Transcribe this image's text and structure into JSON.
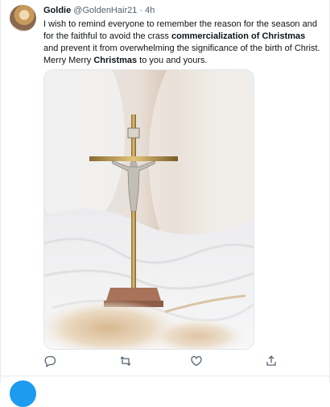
{
  "tweet": {
    "display_name": "Goldie",
    "handle": "@GoldenHair21",
    "separator": "·",
    "timestamp": "4h",
    "text_parts": [
      "I wish to remind everyone to remember the reason for the season and for the faithful to avoid the crass ",
      "commercialization of Christmas",
      " and prevent it from overwhelming the significance of the birth of Christ. Merry Merry ",
      "Christmas",
      " to you and yours."
    ]
  },
  "media": {
    "icon": "crucifix-photo"
  },
  "actions": [
    {
      "name": "reply",
      "icon": "reply-icon"
    },
    {
      "name": "retweet",
      "icon": "retweet-icon"
    },
    {
      "name": "like",
      "icon": "heart-icon"
    },
    {
      "name": "share",
      "icon": "share-icon"
    }
  ],
  "colors": {
    "text": "#0f1419",
    "secondary": "#536471",
    "accent": "#1d9bf0",
    "border": "#e7ebee"
  }
}
